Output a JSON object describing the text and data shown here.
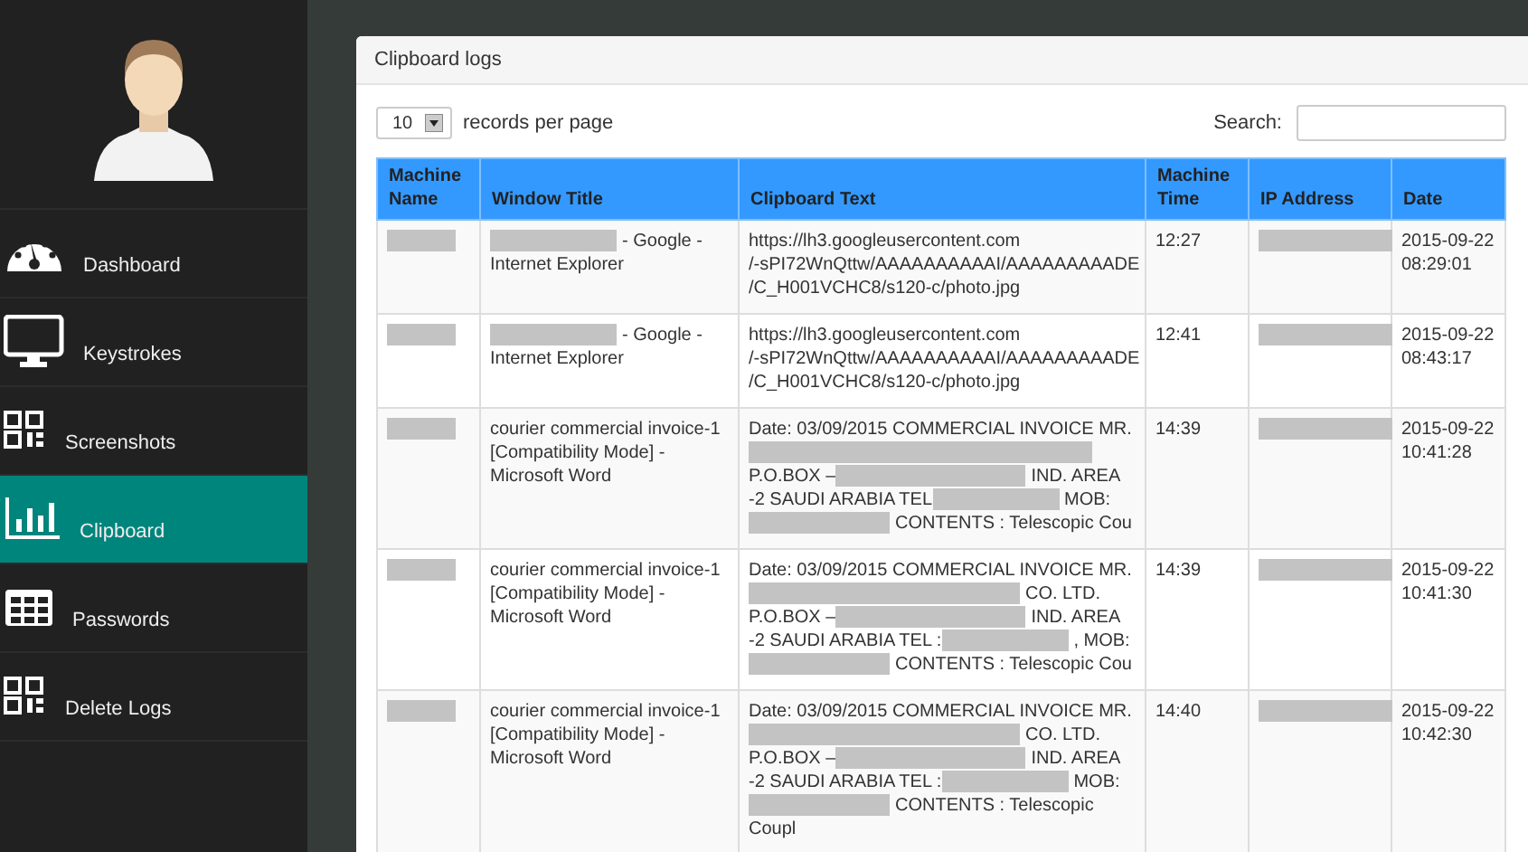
{
  "sidebar": {
    "items": [
      {
        "label": "Dashboard",
        "selected": false
      },
      {
        "label": "Keystrokes",
        "selected": false
      },
      {
        "label": "Screenshots",
        "selected": false
      },
      {
        "label": "Clipboard",
        "selected": true
      },
      {
        "label": "Passwords",
        "selected": false
      },
      {
        "label": "Delete Logs",
        "selected": false
      }
    ]
  },
  "panel": {
    "title": "Clipboard logs",
    "page_size": {
      "value": "10",
      "label": "records per page"
    },
    "search": {
      "label": "Search:"
    },
    "table": {
      "columns": [
        [
          "Machine",
          "Name"
        ],
        [
          "Window Title"
        ],
        [
          "Clipboard Text"
        ],
        [
          "Machine",
          "Time"
        ],
        [
          "IP Address"
        ],
        [
          "Date"
        ]
      ],
      "rows": [
        {
          "machine_name": [
            {
              "kind": "redacted"
            }
          ],
          "window_title": [
            [
              {
                "kind": "redacted"
              },
              {
                "kind": "text",
                "text": "- Google -"
              }
            ],
            [
              {
                "kind": "text",
                "text": "Internet Explorer"
              }
            ]
          ],
          "clipboard_text": [
            [
              {
                "kind": "text",
                "text": "https://lh3.googleusercontent.com"
              }
            ],
            [
              {
                "kind": "text",
                "text": "/-sPI72WnQttw/AAAAAAAAAAI/AAAAAAAAADE"
              }
            ],
            [
              {
                "kind": "text",
                "text": "/C_H001VCHC8/s120-c/photo.jpg"
              }
            ]
          ],
          "machine_time": "12:27",
          "ip_address": [
            {
              "kind": "redacted"
            }
          ],
          "date": "2015-09-22 08:29:01"
        },
        {
          "machine_name": [
            {
              "kind": "redacted"
            }
          ],
          "window_title": [
            [
              {
                "kind": "redacted"
              },
              {
                "kind": "text",
                "text": "- Google -"
              }
            ],
            [
              {
                "kind": "text",
                "text": "Internet Explorer"
              }
            ]
          ],
          "clipboard_text": [
            [
              {
                "kind": "text",
                "text": "https://lh3.googleusercontent.com"
              }
            ],
            [
              {
                "kind": "text",
                "text": "/-sPI72WnQttw/AAAAAAAAAAI/AAAAAAAAADE"
              }
            ],
            [
              {
                "kind": "text",
                "text": "/C_H001VCHC8/s120-c/photo.jpg"
              }
            ]
          ],
          "machine_time": "12:41",
          "ip_address": [
            {
              "kind": "redacted"
            }
          ],
          "date": "2015-09-22 08:43:17"
        },
        {
          "machine_name": [
            {
              "kind": "redacted"
            }
          ],
          "window_title": [
            {
              "kind": "text",
              "text": "courier commercial invoice-1 [Compatibility Mode] - Microsoft Word"
            }
          ],
          "clipboard_text": [
            [
              {
                "kind": "text",
                "text": "Date: 03/09/2015 COMMERCIAL INVOICE MR."
              }
            ],
            [
              {
                "kind": "redacted"
              }
            ],
            [
              {
                "kind": "text",
                "text": "P.O.BOX –"
              },
              {
                "kind": "redacted"
              },
              {
                "kind": "text",
                "text": "IND. AREA"
              }
            ],
            [
              {
                "kind": "text",
                "text": "-2 SAUDI ARABIA TEL"
              },
              {
                "kind": "redacted"
              },
              {
                "kind": "text",
                "text": "MOB:"
              }
            ],
            [
              {
                "kind": "redacted"
              },
              {
                "kind": "text",
                "text": "CONTENTS : Telescopic Cou"
              }
            ]
          ],
          "machine_time": "14:39",
          "ip_address": [
            {
              "kind": "redacted"
            }
          ],
          "date": "2015-09-22 10:41:28"
        },
        {
          "machine_name": [
            {
              "kind": "redacted"
            }
          ],
          "window_title": [
            {
              "kind": "text",
              "text": "courier commercial invoice-1 [Compatibility Mode] - Microsoft Word"
            }
          ],
          "clipboard_text": [
            [
              {
                "kind": "text",
                "text": "Date: 03/09/2015 COMMERCIAL INVOICE MR."
              }
            ],
            [
              {
                "kind": "redacted"
              },
              {
                "kind": "text",
                "text": "CO. LTD."
              }
            ],
            [
              {
                "kind": "text",
                "text": "P.O.BOX –"
              },
              {
                "kind": "redacted"
              },
              {
                "kind": "text",
                "text": "IND. AREA"
              }
            ],
            [
              {
                "kind": "text",
                "text": "-2 SAUDI ARABIA TEL :"
              },
              {
                "kind": "redacted"
              },
              {
                "kind": "text",
                "text": ", MOB:"
              }
            ],
            [
              {
                "kind": "redacted"
              },
              {
                "kind": "text",
                "text": "CONTENTS : Telescopic Cou"
              }
            ]
          ],
          "machine_time": "14:39",
          "ip_address": [
            {
              "kind": "redacted"
            }
          ],
          "date": "2015-09-22 10:41:30"
        },
        {
          "machine_name": [
            {
              "kind": "redacted"
            }
          ],
          "window_title": [
            {
              "kind": "text",
              "text": "courier commercial invoice-1 [Compatibility Mode] - Microsoft Word"
            }
          ],
          "clipboard_text": [
            [
              {
                "kind": "text",
                "text": "Date: 03/09/2015 COMMERCIAL INVOICE MR."
              }
            ],
            [
              {
                "kind": "redacted"
              },
              {
                "kind": "text",
                "text": "CO. LTD."
              }
            ],
            [
              {
                "kind": "text",
                "text": "P.O.BOX –"
              },
              {
                "kind": "redacted"
              },
              {
                "kind": "text",
                "text": "IND. AREA"
              }
            ],
            [
              {
                "kind": "text",
                "text": "-2 SAUDI ARABIA TEL :"
              },
              {
                "kind": "redacted"
              },
              {
                "kind": "text",
                "text": "MOB:"
              }
            ],
            [
              {
                "kind": "redacted"
              },
              {
                "kind": "text",
                "text": "CONTENTS : Telescopic"
              }
            ],
            [
              {
                "kind": "text",
                "text": "Coupl"
              }
            ]
          ],
          "machine_time": "14:40",
          "ip_address": [
            {
              "kind": "redacted"
            }
          ],
          "date": "2015-09-22 10:42:30"
        }
      ]
    }
  }
}
